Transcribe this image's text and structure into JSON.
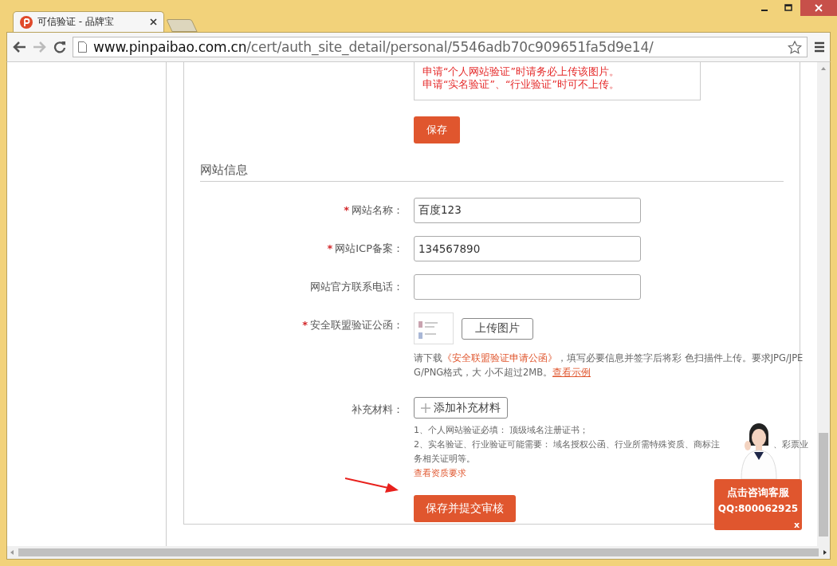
{
  "browser": {
    "tab_title": "可信验证 - 品牌宝",
    "url_host": "www.pinpaibao.com.cn",
    "url_path": "/cert/auth_site_detail/personal/5546adb70c909651fa5d9e14/"
  },
  "notice": [
    "申请“个人网站验证”时请务必上传该图片。",
    "申请“实名验证”、“行业验证”时可不上传。"
  ],
  "save_button": "保存",
  "section_title": "网站信息",
  "fields": [
    {
      "kind": "input",
      "required_mark": "*",
      "label": "网站名称：",
      "value": "百度123"
    },
    {
      "kind": "input",
      "required_mark": "*",
      "label": "网站ICP备案：",
      "value": "134567890"
    },
    {
      "kind": "input",
      "label": "网站官方联系电话："
    },
    {
      "kind": "upload",
      "required_mark": "*",
      "label": "安全联盟验证公函：",
      "button": "上传图片",
      "help_before": "请下载",
      "help_link": "《安全联盟验证申请公函》",
      "help_after": "，填写必要信息并签字后将彩 色扫描件上传。要求JPG/JPEG/PNG格式，大 小不超过2MB。",
      "example_link": "查看示例"
    },
    {
      "kind": "materials",
      "label": "补充材料：",
      "button": "添加补充材料",
      "note_1": "1、个人网站验证必填： 顶级域名注册证书；",
      "note_2_before": "2、实名验证、行业验证可能需要： 域名授权公函、行业所需特殊资质、商标注",
      "note_2_after": "、彩票业",
      "note_3": "务相关证明等。",
      "link": "查看资质要求"
    }
  ],
  "submit_button": "保存并提交审核",
  "service": {
    "title": "点击咨询客服",
    "qq": "QQ:800062925",
    "close": "x"
  }
}
